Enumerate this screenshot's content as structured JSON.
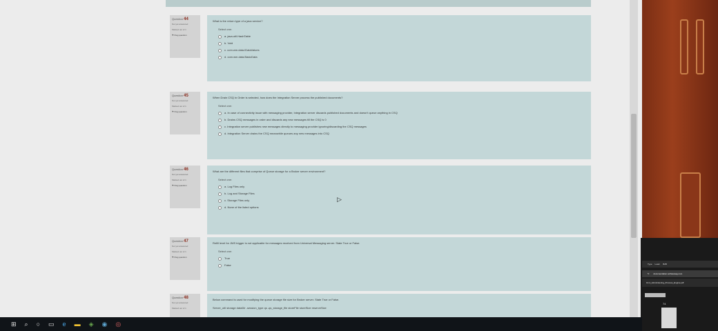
{
  "questions": [
    {
      "number_label": "Question",
      "number": "44",
      "status": "Not yet answered",
      "marks": "Marked out of 1",
      "flag": "Flag question",
      "text": "What is the return type of a java service?",
      "select_label": "Select one:",
      "options": [
        "a. java.util.HashTable",
        "b. Void",
        "c. com.wm.data.IDataValues",
        "d. com.wm.data.BasicData"
      ]
    },
    {
      "number_label": "Question",
      "number": "45",
      "status": "Not yet answered",
      "marks": "Marked out of 1",
      "flag": "Flag question",
      "text": "When Drain CSQ in Order is selected, how does the Integration Server process the published documents?",
      "select_label": "Select one:",
      "options": [
        "a. In case of connectivity issue with messaging provider, Integration server discards published documents and doesn't queue anything in CSQ",
        "b. Drains CSQ messages in order and discards any new messages till the CSQ is 0",
        "c. Integration server publishes new messages directly to messaging provider ignoring/discarding the CSQ messages",
        "d. Integration Server drains the CSQ meanwhile queues any new messages into CSQ"
      ]
    },
    {
      "number_label": "Question",
      "number": "46",
      "status": "Not yet answered",
      "marks": "Marked out of 1",
      "flag": "Flag question",
      "text": "What are the different files that comprise of Queue storage for a Broker server environment?",
      "select_label": "Select one:",
      "options": [
        "a. Log Files only",
        "b. Log and Storage Files",
        "c. Storage Files only",
        "d. None of the listed options"
      ]
    },
    {
      "number_label": "Question",
      "number": "47",
      "status": "Not yet answered",
      "marks": "Marked out of 1",
      "flag": "Flag question",
      "text": "Refill level for JMS trigger is not applicable for messages received from Universal Messaging server. State True or False.",
      "select_label": "Select one:",
      "options": [
        "True",
        "False"
      ]
    },
    {
      "number_label": "Question",
      "number": "48",
      "status": "Not yet answered",
      "marks": "Marked out of 1",
      "flag": "",
      "text": "Below command is used for modifying the queue storage file size for Broker server. State True or False.",
      "select_label": "",
      "options": [
        "Server_util storage dataDir -session_type qs -qs_storage_file storeFile storeSize reserveSize"
      ]
    }
  ],
  "second_monitor": {
    "tabs": [
      "Type",
      "Learn",
      "B2B"
    ],
    "url": "documentation.softwareag.com",
    "doc_title": "10-4_Administering_Process_Engine.pdf",
    "page_number": "74"
  },
  "colors": {
    "question_panel": "#c3d7d8",
    "info_panel": "#d3d3d3",
    "question_number": "#8a2c1e",
    "taskbar": "#101418"
  }
}
